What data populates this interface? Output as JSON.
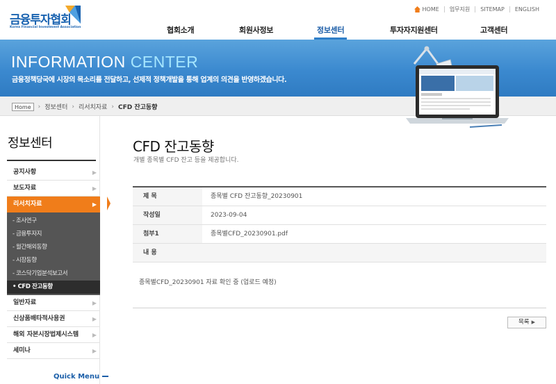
{
  "header": {
    "logo_text": "금융투자협회",
    "logo_sub": "Korea Financial Investment Association",
    "util": [
      "HOME",
      "업무지원",
      "SITEMAP",
      "ENGLISH"
    ],
    "gnb": [
      "협회소개",
      "회원사정보",
      "정보센터",
      "투자자지원센터",
      "고객센터"
    ],
    "gnb_active": "정보센터"
  },
  "banner": {
    "title_main": "INFORMATION",
    "title_accent": "CENTER",
    "desc": "금융정책당국에 시장의 목소리를 전달하고, 선제적 정책개발을 통해 업계의 의견을 반영하겠습니다."
  },
  "breadcrumb": {
    "home": "Home",
    "items": [
      "정보센터",
      "리서치자료",
      "CFD 잔고동향"
    ]
  },
  "sidebar": {
    "title": "정보센터",
    "menu": [
      {
        "label": "공지사항"
      },
      {
        "label": "보도자료"
      },
      {
        "label": "리서치자료",
        "active": true
      }
    ],
    "submenu": [
      "- 조사연구",
      "- 금융투자지",
      "- 월간해외동향",
      "- 시장동향",
      "- 코스닥기업분석보고서",
      "• CFD 잔고동향"
    ],
    "menu_after": [
      {
        "label": "일반자료"
      },
      {
        "label": "신상품배타적사용권"
      },
      {
        "label": "해외 자본시장법제시스템"
      },
      {
        "label": "세미나"
      }
    ],
    "quick_menu": "Quick Menu"
  },
  "content": {
    "title": "CFD 잔고동향",
    "desc": "개별 종목별 CFD 잔고 등을 제공합니다.",
    "rows": [
      {
        "label": "제 목",
        "value": "종목별 CFD 잔고동향_20230901"
      },
      {
        "label": "작성일",
        "value": "2023-09-04"
      },
      {
        "label": "첨부1",
        "value": "종목별CFD_20230901.pdf"
      },
      {
        "label": "내 용",
        "value": ""
      }
    ],
    "body": "종목별CFD_20230901 자료 확인 중 (업로드 예정)",
    "list_button": "목록"
  },
  "colors": {
    "brand_blue": "#1a63b0",
    "banner_blue": "#3d8fd4",
    "accent_orange": "#f07d1a"
  }
}
